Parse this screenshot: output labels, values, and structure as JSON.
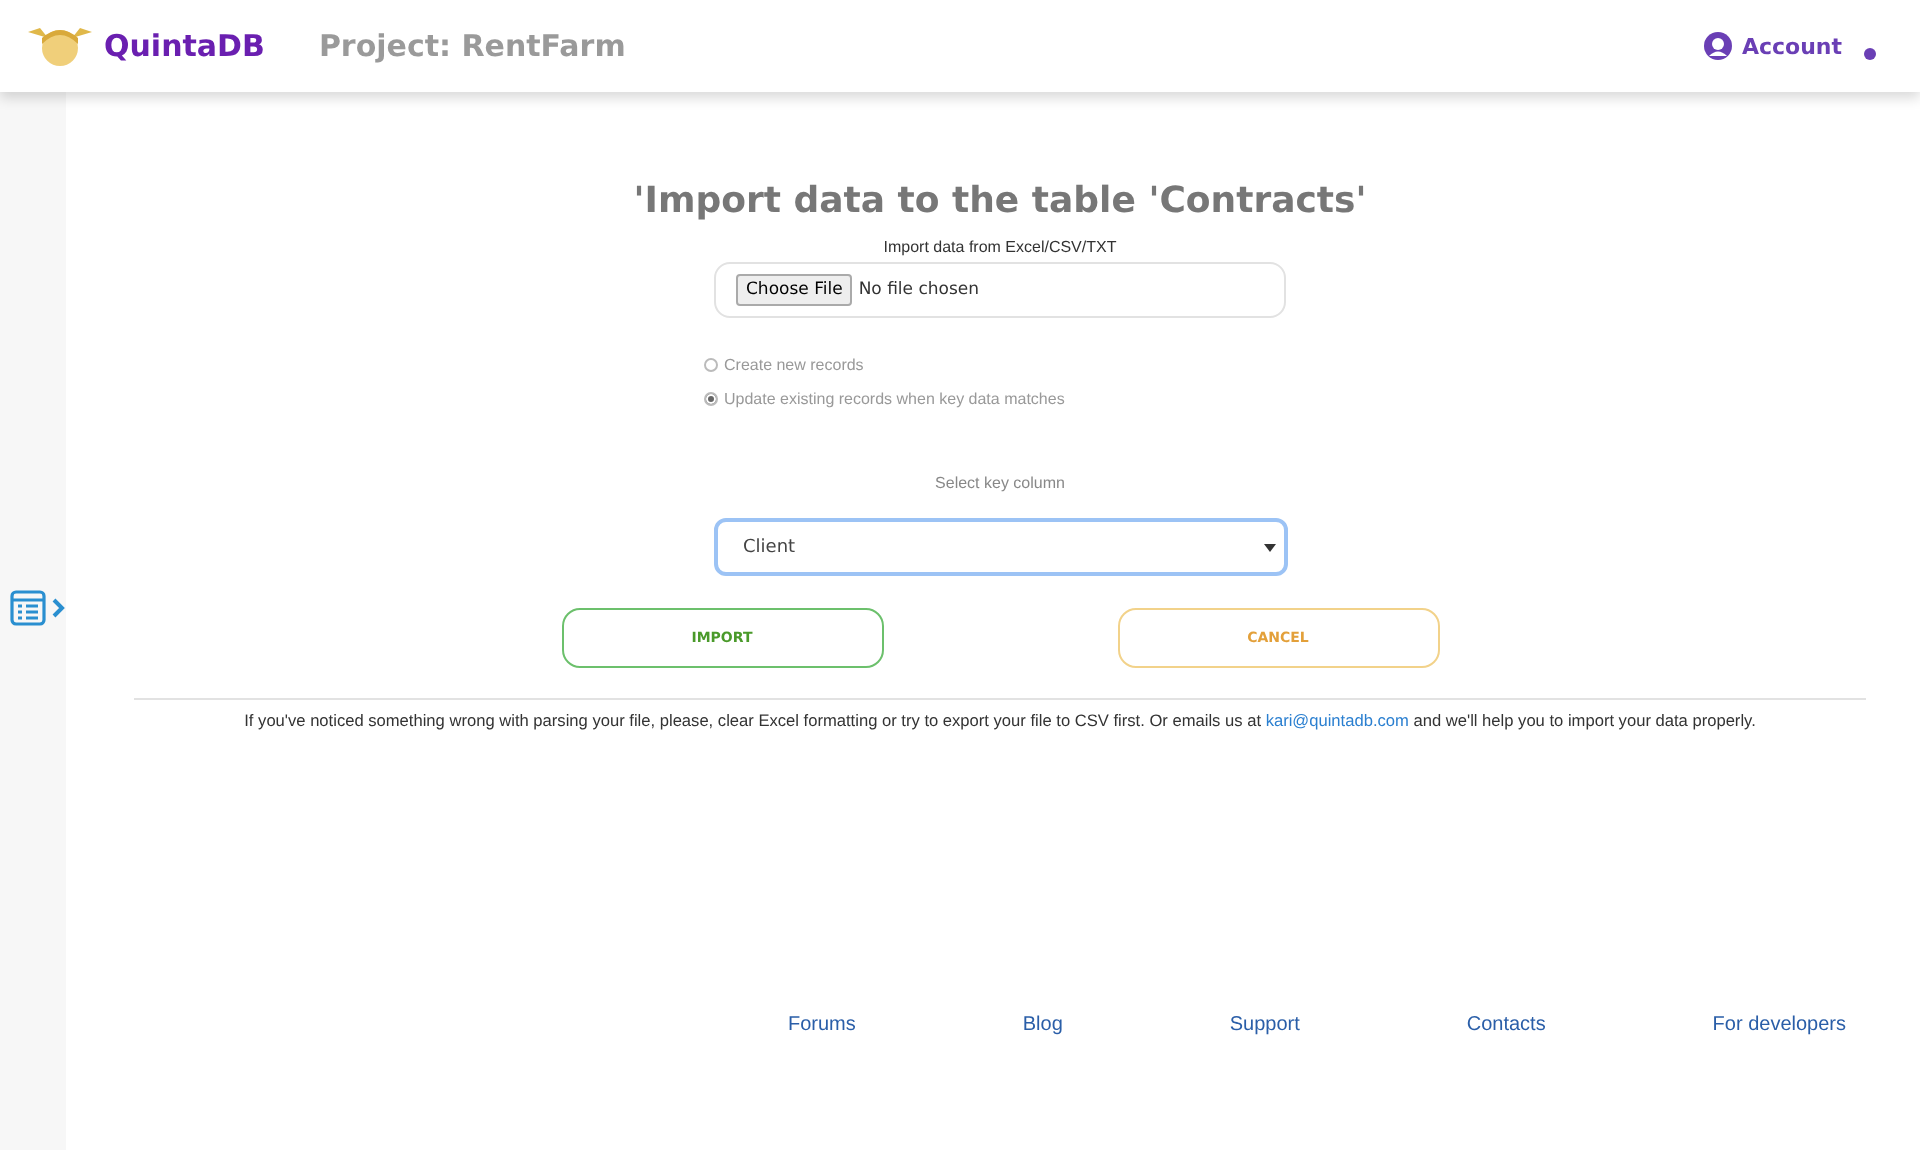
{
  "header": {
    "brand": "QuintaDB",
    "project": "Project: RentFarm",
    "account": "Account"
  },
  "title": "'Import data to the table 'Contracts'",
  "file_input": {
    "label": "Import data from Excel/CSV/TXT",
    "button": "Choose File",
    "status": "No file chosen"
  },
  "options": [
    {
      "label": "Create new records",
      "selected": false
    },
    {
      "label": "Update existing records when key data matches",
      "selected": true
    }
  ],
  "key_column": {
    "label": "Select key column",
    "value": "Client"
  },
  "buttons": [
    {
      "label": "IMPORT",
      "kind": "import"
    },
    {
      "label": "CANCEL",
      "kind": "cancel"
    }
  ],
  "note": {
    "before": "If you've noticed something wrong with parsing your file, please, clear Excel formatting or try to export your file to CSV first. Or emails us at ",
    "link": "kari@quintadb.com",
    "after": " and we'll help you to import your data properly."
  },
  "footer_links": [
    "Forums",
    "Blog",
    "Support",
    "Contacts",
    "For developers"
  ]
}
